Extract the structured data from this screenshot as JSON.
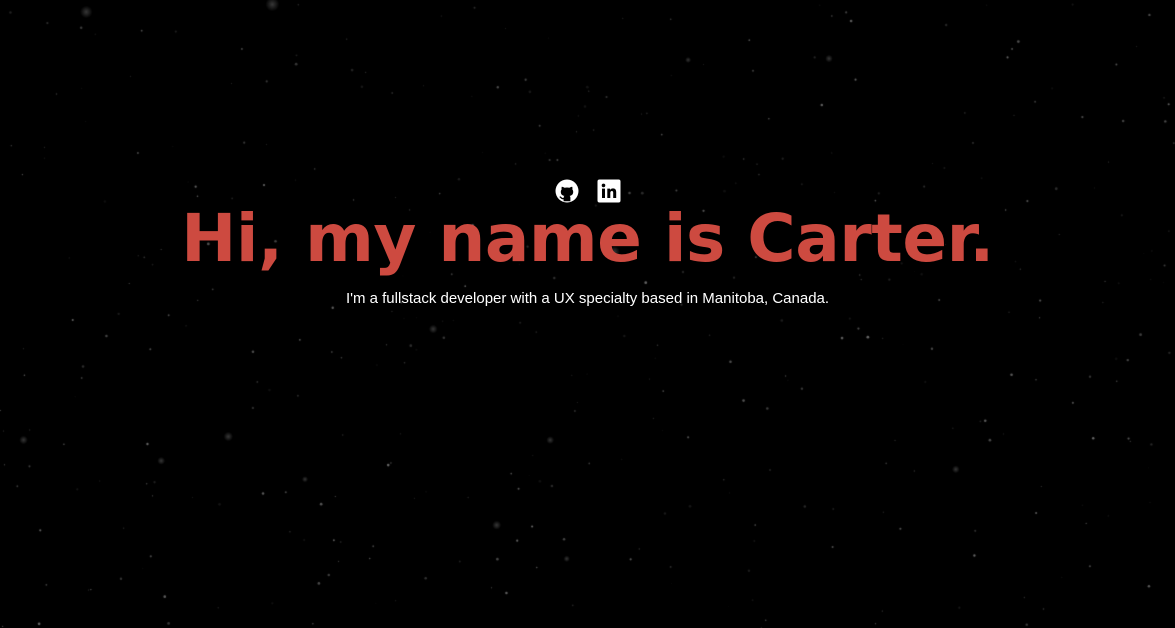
{
  "colors": {
    "background": "#000000",
    "accent": "#cd4a40",
    "text": "#ffffff",
    "icon": "#ffffff"
  },
  "social_links": [
    {
      "name": "github",
      "icon": "github-icon"
    },
    {
      "name": "linkedin",
      "icon": "linkedin-icon"
    }
  ],
  "hero": {
    "title": "Hi, my name is Carter.",
    "subtitle": "I'm a fullstack developer with a UX specialty based in Manitoba, Canada."
  }
}
